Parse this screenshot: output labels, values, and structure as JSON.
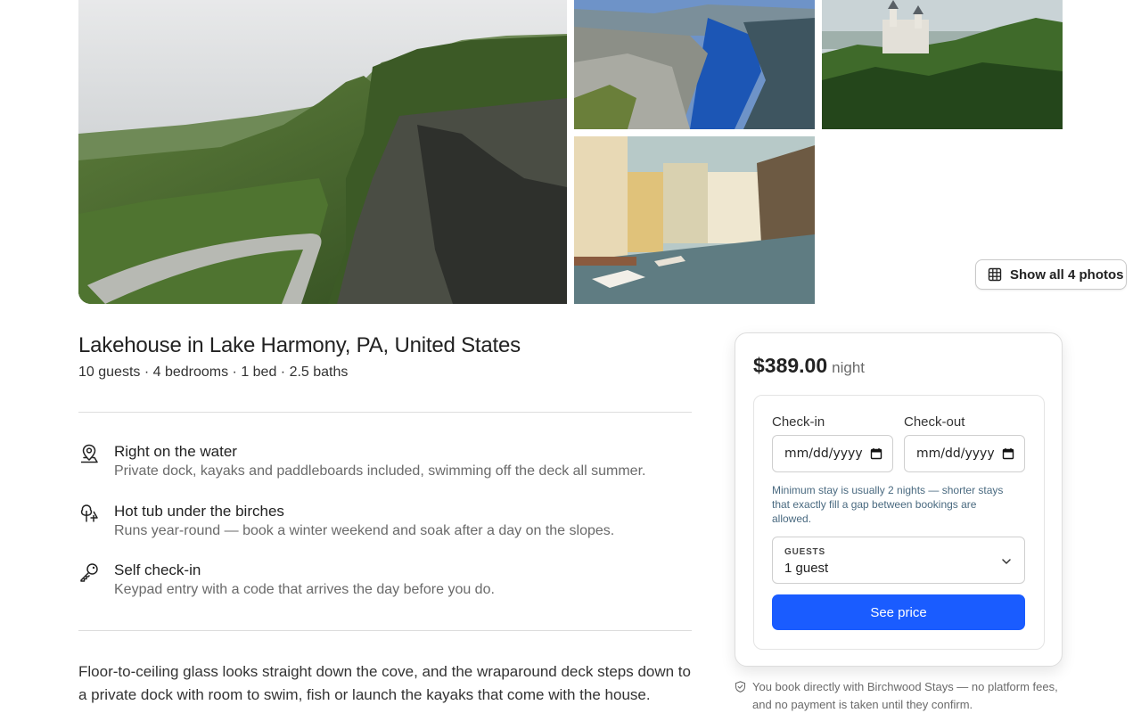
{
  "gallery": {
    "photos": [
      {
        "name": "green-cliffs-valley-road"
      },
      {
        "name": "fjord-blue-water"
      },
      {
        "name": "castle-on-forested-hill"
      },
      {
        "name": "canal-town-boats"
      }
    ],
    "show_all_label": "Show all 4 photos",
    "show_all_icon": "grid-icon"
  },
  "listing": {
    "title": "Lakehouse in Lake Harmony, PA, United States",
    "specs": "10 guests · 4 bedrooms · 1 bed · 2.5 baths"
  },
  "features": [
    {
      "icon": "map-pin-person-icon",
      "heading": "Right on the water",
      "text": "Private dock, kayaks and paddleboards included, swimming off the deck all summer."
    },
    {
      "icon": "trees-icon",
      "heading": "Hot tub under the birches",
      "text": "Runs year-round — book a winter weekend and soak after a day on the slopes."
    },
    {
      "icon": "key-icon",
      "heading": "Self check-in",
      "text": "Keypad entry with a code that arrives the day before you do."
    }
  ],
  "description": "Floor-to-ceiling glass looks straight down the cove, and the wraparound deck steps down to a private dock with room to swim, fish or launch the kayaks that come with the house.",
  "booking": {
    "price": "$389.00",
    "price_unit": "night",
    "checkin_label": "Check-in",
    "checkin_placeholder": "mm/dd/yyyy",
    "checkout_label": "Check-out",
    "checkout_placeholder": "mm/dd/yyyy",
    "min_stay_note": "Minimum stay is usually 2 nights — shorter stays that exactly fill a gap between bookings are allowed.",
    "guests_label": "GUESTS",
    "guests_value": "1 guest",
    "cta_label": "See price",
    "accent_color": "#1a5cff"
  },
  "trust_note": "You book directly with Birchwood Stays — no platform fees, and no payment is taken until they confirm."
}
